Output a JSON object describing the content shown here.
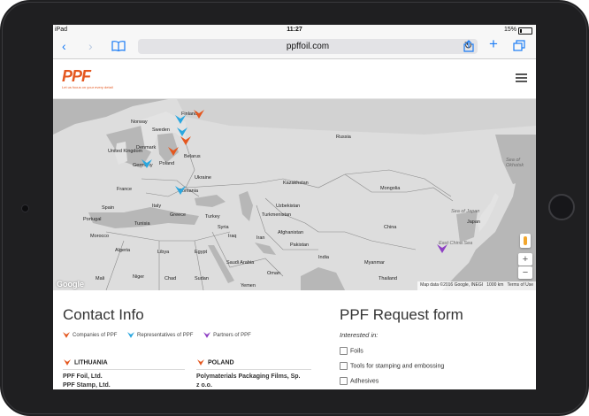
{
  "status_bar": {
    "carrier": "iPad",
    "time": "11:27",
    "battery": "15%"
  },
  "browser": {
    "url": "ppffoil.com"
  },
  "header": {
    "logo_text": "PPF",
    "tagline": "Let us focus on your every detail"
  },
  "map": {
    "labels": {
      "finland": "Finland",
      "norway": "Norway",
      "sweden": "Sweden",
      "russia": "Russia",
      "denmark": "Denmark",
      "belarus": "Belarus",
      "united_kingdom": "United Kingdom",
      "poland": "Poland",
      "ukraine": "Ukraine",
      "germany": "Germany",
      "france": "France",
      "spain": "Spain",
      "portugal": "Portugal",
      "italy": "Italy",
      "romania": "Romania",
      "greece": "Greece",
      "turkey": "Turkey",
      "kazakhstan": "Kazakhstan",
      "mongolia": "Mongolia",
      "uzbekistan": "Uzbekistan",
      "turkmenistan": "Turkmenistan",
      "tunisia": "Tunisia",
      "syria": "Syria",
      "iraq": "Iraq",
      "iran": "Iran",
      "afghanistan": "Afghanistan",
      "pakistan": "Pakistan",
      "morocco": "Morocco",
      "algeria": "Algeria",
      "libya": "Libya",
      "egypt": "Egypt",
      "saudi_arabia": "Saudi Arabia",
      "oman": "Oman",
      "india": "India",
      "china": "China",
      "myanmar": "Myanmar",
      "thailand": "Thailand",
      "mali": "Mali",
      "niger": "Niger",
      "chad": "Chad",
      "sudan": "Sudan",
      "yemen": "Yemen",
      "sea_of_okhotsk": "Sea of Okhotsk",
      "sea_of_japan": "Sea of Japan",
      "east_china_sea": "East China Sea",
      "japan": "Japan"
    },
    "google": "Google",
    "attribution": "Map data ©2016 Google, INEGI",
    "scale": "1000 km",
    "terms": "Terms of Use",
    "zoom_in": "+",
    "zoom_out": "−"
  },
  "colors": {
    "companies": "#e4571f",
    "representatives": "#2aa7e0",
    "partners": "#8e3fc4",
    "brand": "#e4571f"
  },
  "contact": {
    "title": "Contact Info",
    "legend": {
      "companies": "Companies of PPF",
      "representatives": "Representatives of PPF",
      "partners": "Partners of PPF"
    },
    "col1": {
      "country": "LITHUANIA",
      "line1": "PPF Foil, Ltd.",
      "line2": "PPF Stamp, Ltd."
    },
    "col2": {
      "country": "POLAND",
      "line1": "Polymaterials Packaging Films, Sp.",
      "line2": "z o.o."
    }
  },
  "request": {
    "title": "PPF Request form",
    "interested": "Interested in:",
    "options": [
      "Foils",
      "Tools for stamping and embossing",
      "Adhesives"
    ]
  }
}
